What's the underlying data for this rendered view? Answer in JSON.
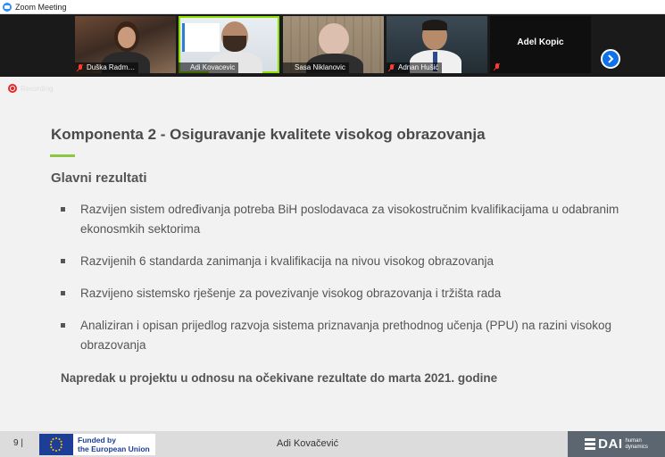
{
  "window": {
    "title": "Zoom Meeting"
  },
  "participants": [
    {
      "name": "Duška Radm…",
      "muted": true
    },
    {
      "name": "Adi Kovacevic",
      "muted": false,
      "active_speaker": true
    },
    {
      "name": "Sasa Niklanovic",
      "muted": false
    },
    {
      "name": "Adnan Hušić",
      "muted": true
    },
    {
      "name": "Adel Kopic",
      "muted": true,
      "video_off": true
    }
  ],
  "recording": {
    "label": "Recording"
  },
  "slide": {
    "title": "Komponenta 2 - Osiguravanje kvalitete visokog obrazovanja",
    "subheading": "Glavni rezultati",
    "bullets": [
      "Razvijen sistem određivanja potreba BiH poslodavaca za visokostručnim kvalifikacijama u odabranim ekonosmkih sektorima",
      "Razvijenih 6 standarda zanimanja i kvalifikacija na nivou visokog obrazovanja",
      "Razvijeno sistemsko rješenje za povezivanje visokog obrazovanja i tržišta rada",
      "Analiziran i opisan prijedlog razvoja sistema priznavanja prethodnog učenja (PPU) na razini visokog obrazovanja"
    ],
    "conclusion": "Napredak u projektu u odnosu na očekivane rezultate do marta 2021. godine",
    "footer": {
      "page": "9 |",
      "funded_line1": "Funded by",
      "funded_line2": "the European Union",
      "presenter": "Adi Kovačević",
      "dai_logo": "DAI",
      "dai_sub1": "human",
      "dai_sub2": "dynamics"
    },
    "colors": {
      "accent": "#8dc63f",
      "text": "#555555",
      "eu_blue": "#1d3e97",
      "dai_gray": "#5b6670"
    }
  },
  "icons": [
    "zoom-logo-icon",
    "mic-muted-icon",
    "chevron-right-icon",
    "recording-icon",
    "eu-flag-icon",
    "dai-logo-icon"
  ]
}
